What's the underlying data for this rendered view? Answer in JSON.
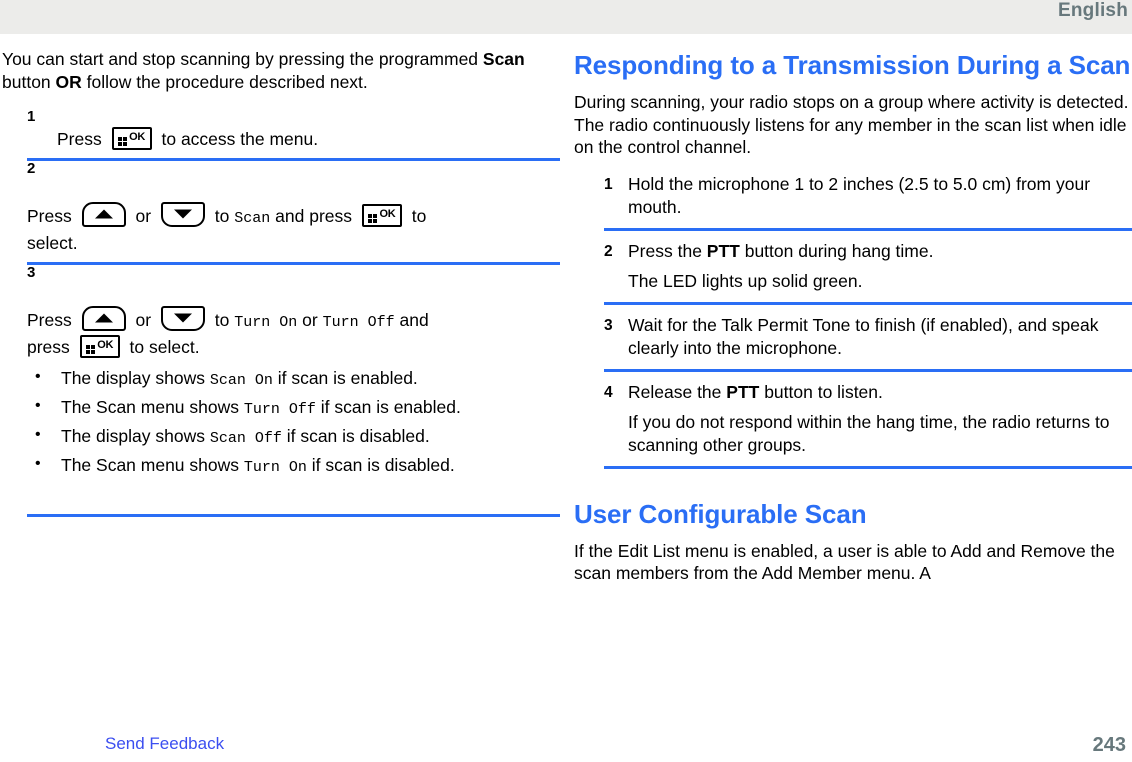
{
  "header": {
    "language": "English"
  },
  "left_column": {
    "intro": {
      "part1": "You can start and stop scanning by pressing the programmed ",
      "bold1": "Scan",
      "part2": " button ",
      "bold2": "OR",
      "part3": " follow the procedure described next."
    },
    "steps": [
      {
        "number": "1",
        "text_before": "Press",
        "icon": "ok-key-icon",
        "text_after": "to access the menu."
      },
      {
        "number": "2",
        "text_before": "Press",
        "icon_up": "up-arrow-key-icon",
        "or_label": "or",
        "icon_down": "down-arrow-key-icon",
        "text_mid": "to",
        "mono_target": "Scan",
        "text_mid2": "and press",
        "icon_ok": "ok-key-icon",
        "text_after": "to",
        "line2": "select."
      },
      {
        "number": "3",
        "text_before": "Press",
        "icon_up": "up-arrow-key-icon",
        "or_label": "or",
        "icon_down": "down-arrow-key-icon",
        "text_mid": "to",
        "mono_option_1": "Turn On",
        "or_label2": "or",
        "mono_option_2": "Turn Off",
        "text_after": "and",
        "line2_before": "press",
        "icon_ok": "ok-key-icon",
        "line2_after": "to select.",
        "bullets": [
          {
            "a": "The display shows ",
            "mono": "Scan On",
            "b": " if scan is enabled."
          },
          {
            "a": "The Scan menu shows ",
            "mono": "Turn Off",
            "b": " if scan is enabled."
          },
          {
            "a": "The display shows ",
            "mono": "Scan Off",
            "b": " if scan is disabled."
          },
          {
            "a": "The Scan menu shows ",
            "mono": "Turn On",
            "b": " if scan is disabled."
          }
        ]
      }
    ]
  },
  "right_column": {
    "section1_title": "Responding to a Transmission During a Scan",
    "section1_intro": "During scanning, your radio stops on a group where activity is detected. The radio continuously listens for any member in the scan list when idle on the control channel.",
    "steps": [
      {
        "number": "1",
        "text": "Hold the microphone 1 to 2 inches (2.5 to 5.0 cm) from your mouth.",
        "sub": ""
      },
      {
        "number": "2",
        "text_before": "Press the ",
        "bold": "PTT",
        "text_after": " button during hang time.",
        "sub": "The LED lights up solid green."
      },
      {
        "number": "3",
        "text": "Wait for the Talk Permit Tone to finish (if enabled), and speak clearly into the microphone.",
        "sub": ""
      },
      {
        "number": "4",
        "text_before": "Release the ",
        "bold": "PTT",
        "text_after": " button to listen.",
        "sub": "If you do not respond within the hang time, the radio returns to scanning other groups."
      }
    ],
    "section2_title": "User Configurable Scan",
    "section2_intro": "If the Edit List menu is enabled, a user is able to Add and Remove the scan members from the Add Member menu. A"
  },
  "footer": {
    "send_feedback": "Send Feedback",
    "page_number": "243"
  },
  "colors": {
    "heading_blue": "#2a6ef5",
    "rule_blue": "#2a6ef5",
    "link_blue": "#3b4ef0",
    "header_gray": "#ececea",
    "header_text": "#67787c"
  }
}
